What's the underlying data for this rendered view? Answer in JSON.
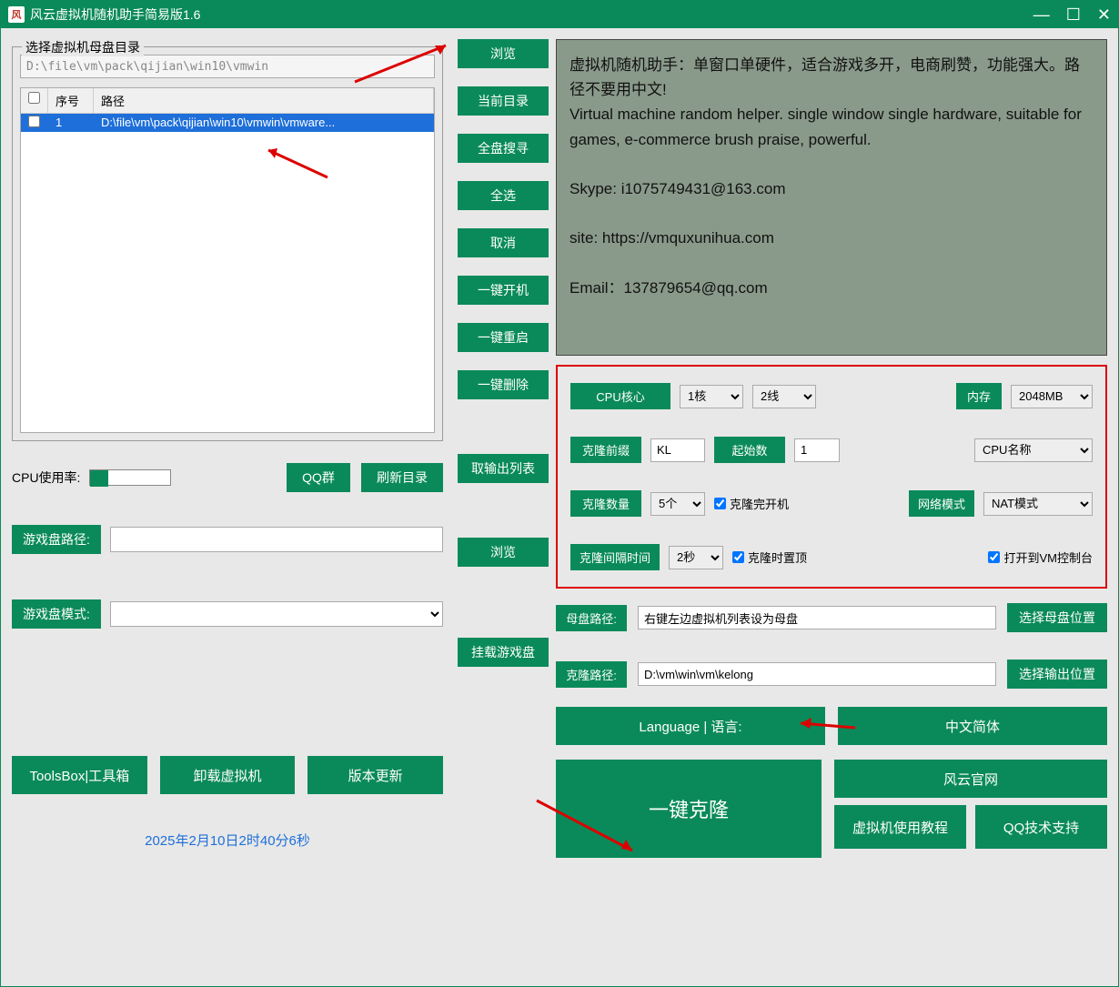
{
  "window": {
    "title": "风云虚拟机随机助手简易版1.6"
  },
  "dir": {
    "group_title": "选择虚拟机母盘目录",
    "path": "D:\\file\\vm\\pack\\qijian\\win10\\vmwin",
    "col_num": "序号",
    "col_path": "路径",
    "row_num": "1",
    "row_path": "D:\\file\\vm\\pack\\qijian\\win10\\vmwin\\vmware..."
  },
  "side": {
    "browse": "浏览",
    "current": "当前目录",
    "fullsearch": "全盘搜寻",
    "selectall": "全选",
    "cancel": "取消",
    "poweron": "一键开机",
    "reboot": "一键重启",
    "delete": "一键删除"
  },
  "cpu": {
    "label": "CPU使用率:"
  },
  "mid": {
    "qq": "QQ群",
    "refresh": "刷新目录",
    "getlist": "取输出列表"
  },
  "game": {
    "path_label": "游戏盘路径:",
    "browse": "浏览",
    "mode_label": "游戏盘模式:",
    "mount": "挂载游戏盘"
  },
  "bottom": {
    "tools": "ToolsBox|工具箱",
    "uninstall": "卸载虚拟机",
    "update": "版本更新"
  },
  "timestamp": "2025年2月10日2时40分6秒",
  "info": {
    "l1": "虚拟机随机助手：单窗口单硬件，适合游戏多开，电商刷赞，功能强大。路径不要用中文!",
    "l2": "Virtual machine random helper. single window single hardware, suitable for games, e-commerce brush praise, powerful.",
    "l3": "Skype: i1075749431@163.com",
    "l4": "site: https://vmquxunihua.com",
    "l5": "Email：137879654@qq.com"
  },
  "settings": {
    "cpu_core": "CPU核心",
    "core_val": "1核",
    "thread_val": "2线",
    "mem": "内存",
    "mem_val": "2048MB",
    "prefix": "克隆前缀",
    "prefix_val": "KL",
    "startnum": "起始数",
    "startnum_val": "1",
    "cpuname": "CPU名称",
    "count": "克隆数量",
    "count_val": "5个",
    "boot_after": "克隆完开机",
    "netmode": "网络模式",
    "netmode_val": "NAT模式",
    "interval": "克隆间隔时间",
    "interval_val": "2秒",
    "topmost": "克隆时置顶",
    "console": "打开到VM控制台"
  },
  "paths": {
    "master": "母盘路径:",
    "master_val": "右键左边虚拟机列表设为母盘",
    "master_btn": "选择母盘位置",
    "clone": "克隆路径:",
    "clone_val": "D:\\vm\\win\\vm\\kelong",
    "clone_btn": "选择输出位置"
  },
  "lang": {
    "label": "Language | 语言:",
    "value": "中文简体"
  },
  "final": {
    "clone": "一键克隆",
    "site": "风云官网",
    "tutorial": "虚拟机使用教程",
    "support": "QQ技术支持"
  }
}
